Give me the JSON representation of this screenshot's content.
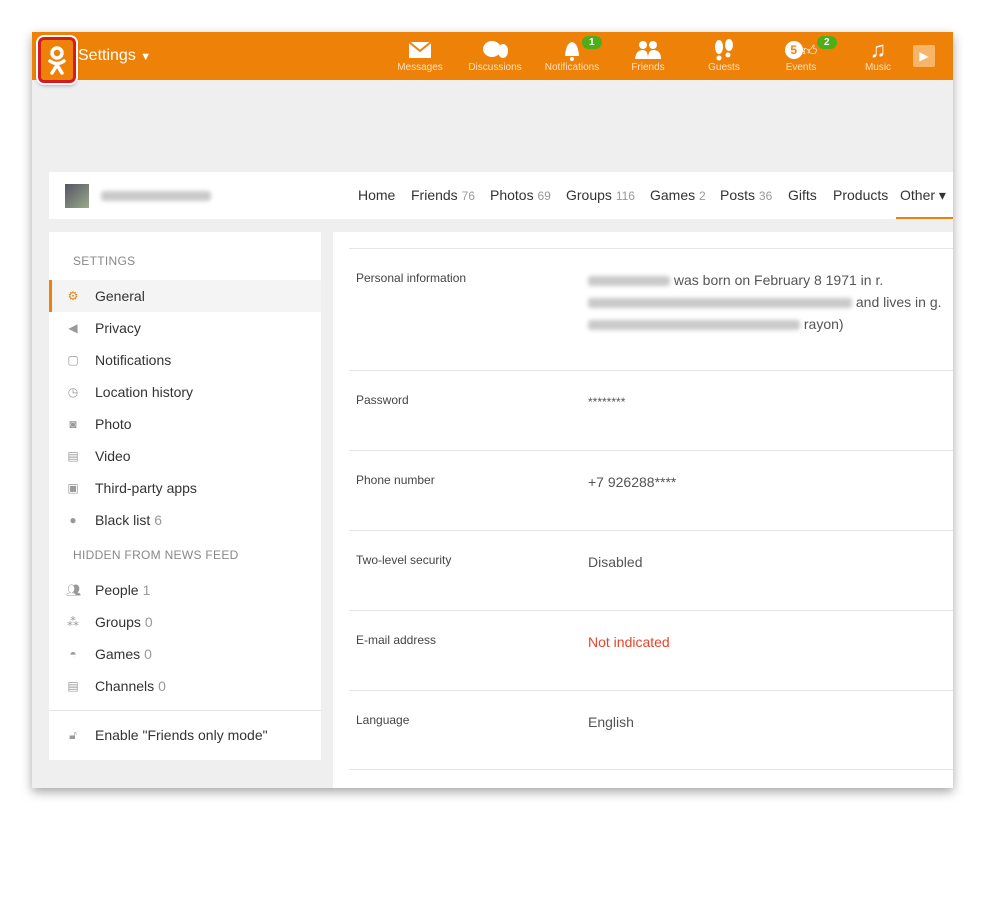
{
  "header": {
    "title": "Settings",
    "nav": [
      {
        "label": "Messages",
        "icon": "envelope-icon"
      },
      {
        "label": "Discussions",
        "icon": "chat-bubbles-icon"
      },
      {
        "label": "Notifications",
        "icon": "bell-icon",
        "badge": "1"
      },
      {
        "label": "Friends",
        "icon": "people-icon"
      },
      {
        "label": "Guests",
        "icon": "footprints-icon"
      },
      {
        "label": "Events",
        "icon": "thumbs-up-icon",
        "badge": "2",
        "count": "5"
      },
      {
        "label": "Music",
        "icon": "music-note-icon"
      }
    ],
    "accent": "#ee8208"
  },
  "profile": {
    "tabs": [
      {
        "label": "Home"
      },
      {
        "label": "Friends",
        "count": "76"
      },
      {
        "label": "Photos",
        "count": "69"
      },
      {
        "label": "Groups",
        "count": "116"
      },
      {
        "label": "Games",
        "count": "2"
      },
      {
        "label": "Posts",
        "count": "36"
      },
      {
        "label": "Gifts"
      },
      {
        "label": "Products"
      },
      {
        "label": "Other ▾"
      }
    ]
  },
  "sidebar": {
    "settings_heading": "SETTINGS",
    "items": [
      {
        "label": "General",
        "icon": "gear-icon"
      },
      {
        "label": "Privacy",
        "icon": "megaphone-icon"
      },
      {
        "label": "Notifications",
        "icon": "notification-icon"
      },
      {
        "label": "Location history",
        "icon": "history-icon"
      },
      {
        "label": "Photo",
        "icon": "camera-icon"
      },
      {
        "label": "Video",
        "icon": "film-icon"
      },
      {
        "label": "Third-party apps",
        "icon": "window-icon"
      },
      {
        "label": "Black list",
        "count": "6",
        "icon": "blocked-user-icon"
      }
    ],
    "hidden_heading": "HIDDEN FROM NEWS FEED",
    "hidden": [
      {
        "label": "People",
        "count": "1",
        "icon": "people-icon"
      },
      {
        "label": "Groups",
        "count": "0",
        "icon": "groups-icon"
      },
      {
        "label": "Games",
        "count": "0",
        "icon": "gamepad-icon"
      },
      {
        "label": "Channels",
        "count": "0",
        "icon": "film-icon"
      }
    ],
    "friends_mode": "Enable \"Friends only mode\""
  },
  "main": {
    "rows": [
      {
        "label": "Personal information",
        "value_parts": [
          "was born on February 8 1971 in r.",
          "and lives in g.",
          "rayon)"
        ]
      },
      {
        "label": "Password",
        "value": "********"
      },
      {
        "label": "Phone number",
        "value": "+7 926288****"
      },
      {
        "label": "Two-level security",
        "value": "Disabled"
      },
      {
        "label": "E-mail address",
        "value": "Not indicated",
        "color": "#e8442b"
      },
      {
        "label": "Language",
        "value": "English"
      }
    ]
  }
}
